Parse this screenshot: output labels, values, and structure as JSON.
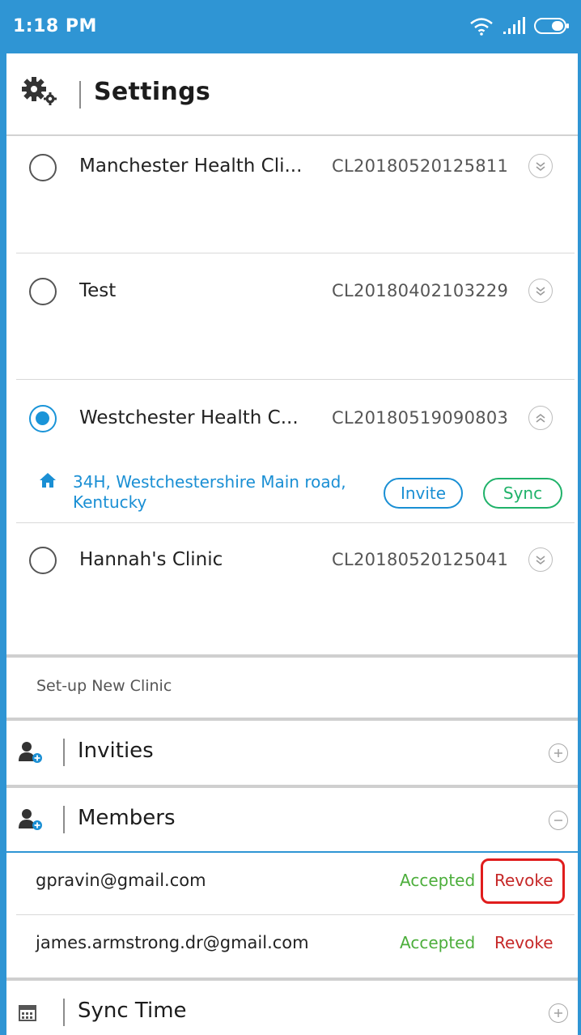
{
  "status_bar": {
    "time": "1:18 PM",
    "icons": [
      "wifi-icon",
      "signal-icon",
      "battery-icon"
    ],
    "color": "#2f95d4"
  },
  "header": {
    "title": "Settings",
    "icon": "gear-icon"
  },
  "clinics": [
    {
      "name": "Manchester Health Cli...",
      "code": "CL20180520125811",
      "selected": false,
      "expanded": false
    },
    {
      "name": "Test",
      "code": "CL20180402103229",
      "selected": false,
      "expanded": false
    },
    {
      "name": "Westchester Health C...",
      "code": "CL20180519090803",
      "selected": true,
      "expanded": true,
      "address": "34H, Westchestershire Main road, Kentucky",
      "invite_label": "Invite",
      "sync_label": "Sync"
    },
    {
      "name": "Hannah's Clinic",
      "code": "CL20180520125041",
      "selected": false,
      "expanded": false
    }
  ],
  "setup_new_clinic": "Set-up New Clinic",
  "sections": {
    "invities": {
      "title": "Invities",
      "expanded": false
    },
    "members": {
      "title": "Members",
      "expanded": true
    },
    "sync_time": {
      "title": "Sync Time",
      "expanded": false
    }
  },
  "members": [
    {
      "email": "gpravin@gmail.com",
      "status": "Accepted",
      "action": "Revoke",
      "highlighted": true
    },
    {
      "email": "james.armstrong.dr@gmail.com",
      "status": "Accepted",
      "action": "Revoke",
      "highlighted": false
    }
  ],
  "colors": {
    "accent": "#2f95d4",
    "link_blue": "#1a8fd4",
    "sync_green": "#20b26a",
    "accepted_green": "#4cae3b",
    "revoke_red": "#c62828",
    "highlight_red": "#e01d1d"
  }
}
